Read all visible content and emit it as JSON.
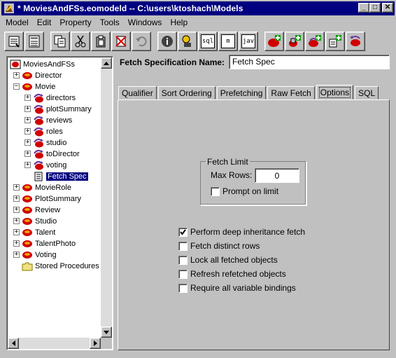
{
  "window": {
    "title": "* MoviesAndFSs.eomodeld  --  C:\\users\\ktoshach\\Models",
    "minimize": "_",
    "maximize": "□",
    "close": "✕"
  },
  "menu": [
    {
      "label": "Model"
    },
    {
      "label": "Edit"
    },
    {
      "label": "Property"
    },
    {
      "label": "Tools"
    },
    {
      "label": "Windows"
    },
    {
      "label": "Help"
    }
  ],
  "toolbar": {
    "buttons": [
      {
        "name": "browse-icon"
      },
      {
        "name": "table-mode-icon"
      },
      {
        "name": "copy-icon"
      },
      {
        "name": "cut-icon"
      },
      {
        "name": "paste-icon"
      },
      {
        "name": "delete-icon"
      },
      {
        "name": "undo-icon"
      },
      {
        "name": "info-icon"
      },
      {
        "name": "inspect-icon"
      },
      {
        "name": "sql-icon",
        "text": "sql"
      },
      {
        "name": "generate-icon",
        "text": "m"
      },
      {
        "name": "java-icon",
        "text": "jav"
      },
      {
        "name": "add-entity-icon"
      },
      {
        "name": "add-attribute-icon"
      },
      {
        "name": "add-relationship-icon"
      },
      {
        "name": "add-fetch-spec-icon"
      },
      {
        "name": "flatten-icon"
      }
    ]
  },
  "tree": {
    "root": "MoviesAndFSs",
    "nodes": [
      {
        "label": "Director",
        "level": 1,
        "expander": "+",
        "icon": "entity"
      },
      {
        "label": "Movie",
        "level": 1,
        "expander": "−",
        "icon": "entity"
      },
      {
        "label": "directors",
        "level": 2,
        "expander": "+",
        "icon": "relationship"
      },
      {
        "label": "plotSummary",
        "level": 2,
        "expander": "+",
        "icon": "relationship"
      },
      {
        "label": "reviews",
        "level": 2,
        "expander": "+",
        "icon": "relationship"
      },
      {
        "label": "roles",
        "level": 2,
        "expander": "+",
        "icon": "relationship"
      },
      {
        "label": "studio",
        "level": 2,
        "expander": "+",
        "icon": "relationship"
      },
      {
        "label": "toDirector",
        "level": 2,
        "expander": "+",
        "icon": "relationship"
      },
      {
        "label": "voting",
        "level": 2,
        "expander": "+",
        "icon": "relationship"
      },
      {
        "label": "Fetch Spec",
        "level": 2,
        "expander": "",
        "icon": "fetchspec",
        "selected": true
      },
      {
        "label": "MovieRole",
        "level": 1,
        "expander": "+",
        "icon": "entity"
      },
      {
        "label": "PlotSummary",
        "level": 1,
        "expander": "+",
        "icon": "entity"
      },
      {
        "label": "Review",
        "level": 1,
        "expander": "+",
        "icon": "entity"
      },
      {
        "label": "Studio",
        "level": 1,
        "expander": "+",
        "icon": "entity"
      },
      {
        "label": "Talent",
        "level": 1,
        "expander": "+",
        "icon": "entity"
      },
      {
        "label": "TalentPhoto",
        "level": 1,
        "expander": "+",
        "icon": "entity"
      },
      {
        "label": "Voting",
        "level": 1,
        "expander": "+",
        "icon": "entity"
      },
      {
        "label": "Stored Procedures",
        "level": 1,
        "expander": "",
        "icon": "folder"
      }
    ]
  },
  "fetch_spec": {
    "name_label": "Fetch Specification Name:",
    "name_value": "Fetch Spec"
  },
  "tabs": [
    {
      "label": "Qualifier",
      "active": false
    },
    {
      "label": "Sort Ordering",
      "active": false
    },
    {
      "label": "Prefetching",
      "active": false
    },
    {
      "label": "Raw Fetch",
      "active": false
    },
    {
      "label": "Options",
      "active": true
    },
    {
      "label": "SQL",
      "active": false
    }
  ],
  "options": {
    "fetch_limit_title": "Fetch Limit",
    "max_rows_label": "Max Rows:",
    "max_rows_value": "0",
    "prompt_on_limit_label": "Prompt on limit",
    "prompt_on_limit_checked": false,
    "checkboxes": [
      {
        "label": "Perform deep inheritance fetch",
        "checked": true
      },
      {
        "label": "Fetch distinct rows",
        "checked": false
      },
      {
        "label": "Lock all fetched objects",
        "checked": false
      },
      {
        "label": "Refresh refetched objects",
        "checked": false
      },
      {
        "label": "Require all variable bindings",
        "checked": false
      }
    ]
  },
  "colors": {
    "titlebar": "#000080",
    "face": "#c0c0c0",
    "entity_red": "#d00000",
    "relationship_purple": "#6a3aa0"
  }
}
